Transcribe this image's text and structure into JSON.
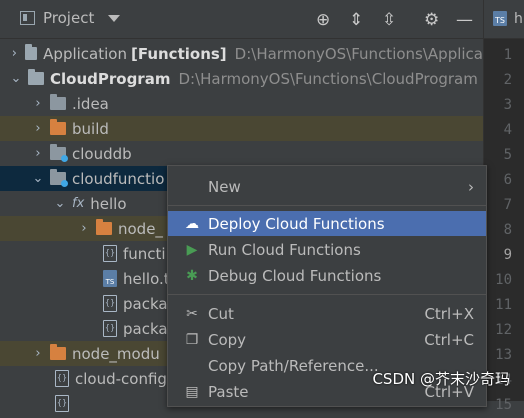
{
  "toolbar": {
    "title": "Project",
    "icons": [
      "target-icon",
      "expand-all-icon",
      "collapse-all-icon",
      "gear-icon",
      "minimize-icon"
    ]
  },
  "editor": {
    "tab_badge": "TS",
    "tab_text": "h",
    "line_numbers": [
      "1",
      "2",
      "3",
      "4",
      "5",
      "6",
      "7",
      "8",
      "9",
      "10",
      "11",
      "12",
      "13",
      "14",
      "15"
    ],
    "current_line": "9"
  },
  "tree": {
    "rows": [
      {
        "name": "Application",
        "suffix": "[Functions]",
        "path": "D:\\HarmonyOS\\Functions\\Applica"
      },
      {
        "name": "CloudProgram",
        "path": "D:\\HarmonyOS\\Functions\\CloudProgram"
      },
      {
        "name": ".idea"
      },
      {
        "name": "build"
      },
      {
        "name": "clouddb"
      },
      {
        "name": "cloudfunctio"
      },
      {
        "name": "hello"
      },
      {
        "name": "node_"
      },
      {
        "name": "functi"
      },
      {
        "name": "hello.t"
      },
      {
        "name": "packa"
      },
      {
        "name": "packa"
      },
      {
        "name": "node_modu"
      },
      {
        "name": "cloud-config"
      },
      {
        "name": ""
      }
    ]
  },
  "menu": {
    "new": "New",
    "deploy": "Deploy Cloud Functions",
    "run": "Run Cloud Functions",
    "debug": "Debug Cloud Functions",
    "cut": "Cut",
    "cut_sc": "Ctrl+X",
    "copy": "Copy",
    "copy_sc": "Ctrl+C",
    "copy_path": "Copy Path/Reference...",
    "paste": "Paste",
    "paste_sc": "Ctrl+V"
  },
  "watermark": "CSDN @芥末沙奇玛",
  "colors": {
    "selection": "#4b6eaf",
    "highlight_row": "#4a4733",
    "selected_row": "#0d293e",
    "folder_orange": "#d68140",
    "run_green": "#499c54"
  }
}
